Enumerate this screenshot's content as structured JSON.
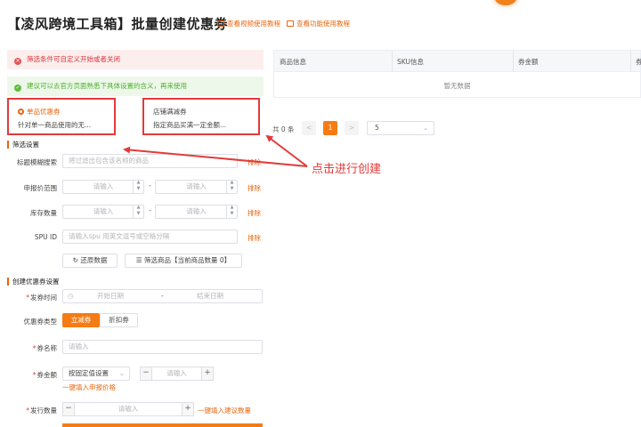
{
  "header": {
    "title": "【凌风跨境工具箱】批量创建优惠券",
    "video_link": "查看视频使用教程",
    "docs_link": "查看功能使用教程"
  },
  "alerts": {
    "error_text": "筛选条件可自定义开始或者关闭",
    "success_text": "建议可以去官方页面熟悉下具体设置的含义，再来使用"
  },
  "coupon_types": [
    {
      "title": "单品优惠券",
      "desc": "针对单一商品使用的无..."
    },
    {
      "title": "店铺满减券",
      "desc": "指定商品买满一定金额..."
    }
  ],
  "filter": {
    "section_title": "筛选设置",
    "title_label": "标题模糊搜索",
    "title_placeholder": "将过滤出包含该名称的商品",
    "price_label": "申报价范围",
    "stock_label": "库存数量",
    "spu_label": "SPU ID",
    "spu_placeholder": "请输入spu 用英文逗号或空格分隔",
    "input_placeholder": "请输入",
    "clear_label": "排除",
    "range_dash": "-",
    "reset_button": "还原数据",
    "filter_button": "筛选商品【当前商品数量 0】"
  },
  "create": {
    "section_title": "创建优惠券设置",
    "time_label": "发券时间",
    "start_placeholder": "开始日期",
    "end_placeholder": "结束日期",
    "date_sep": "-",
    "type_label": "优惠券类型",
    "type_options": [
      "立减券",
      "折扣券"
    ],
    "name_label": "券名称",
    "name_placeholder": "请输入",
    "amount_label": "券金额",
    "amount_select": "按固定值设置",
    "amount_placeholder": "请输入",
    "fill_price_link": "一键填入申报价格",
    "qty_label": "发行数量",
    "qty_placeholder": "请输入",
    "fill_qty_link": "一键填入建议数量",
    "required_mark": "*",
    "minus": "−",
    "plus": "+"
  },
  "table": {
    "columns": [
      "商品信息",
      "SKU信息",
      "券金额",
      "券"
    ],
    "empty_text": "暂无数据"
  },
  "pagination": {
    "total": "共 0 条",
    "prev": "<",
    "current_page": "1",
    "next": ">",
    "page_size": "5"
  },
  "annotation": "点击进行创建",
  "colors": {
    "accent": "#f57c14",
    "error": "#e23b3b",
    "success": "#4caf2f"
  }
}
